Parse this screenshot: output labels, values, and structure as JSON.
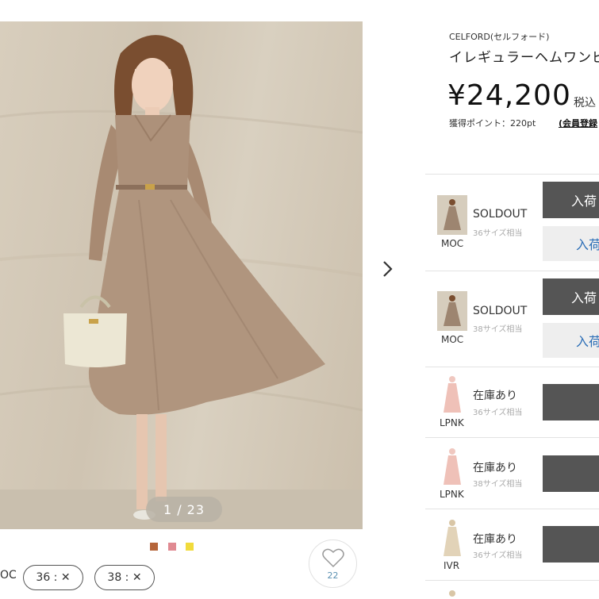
{
  "gallery": {
    "counter": "1 / 23",
    "swatch_colors": [
      "#b5653a",
      "#e08a92",
      "#f1db3c"
    ]
  },
  "sizes": {
    "label": "OC",
    "chips": [
      "36 : ✕",
      "38 : ✕"
    ]
  },
  "like": {
    "count": "22"
  },
  "product": {
    "brand": "CELFORD(セルフォード)",
    "name": "イレギュラーヘムワンピ",
    "price": "¥24,200",
    "tax": "税込",
    "points": "獲得ポイント：220pt",
    "member_link": "(会員登録"
  },
  "stock": [
    {
      "color": "MOC",
      "status": "SOLDOUT",
      "size": "36サイズ相当",
      "btn_dark": "入荷",
      "btn_light": "入荷"
    },
    {
      "color": "MOC",
      "status": "SOLDOUT",
      "size": "38サイズ相当",
      "btn_dark": "入荷",
      "btn_light": "入荷"
    },
    {
      "color": "LPNK",
      "status": "在庫あり",
      "size": "36サイズ相当",
      "btn_dark": "",
      "btn_light": ""
    },
    {
      "color": "LPNK",
      "status": "在庫あり",
      "size": "38サイズ相当",
      "btn_dark": "",
      "btn_light": ""
    },
    {
      "color": "IVR",
      "status": "在庫あり",
      "size": "36サイズ相当",
      "btn_dark": "",
      "btn_light": ""
    }
  ]
}
